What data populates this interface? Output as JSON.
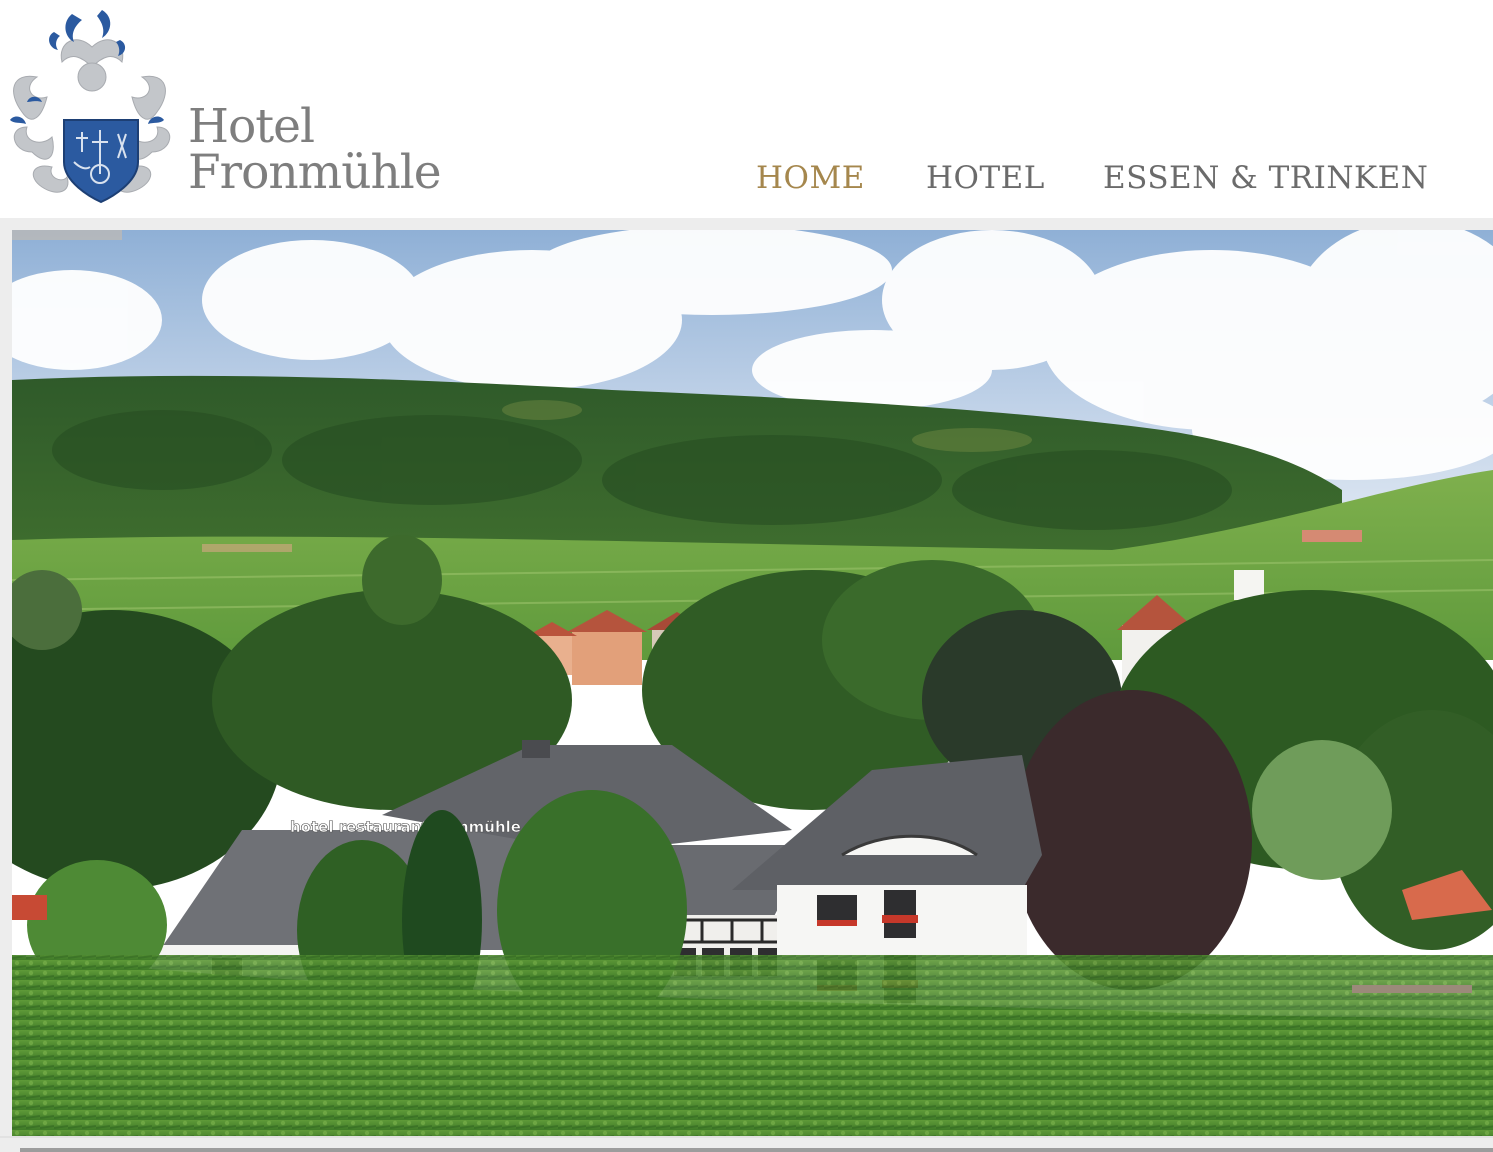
{
  "brand": {
    "line1": "Hotel",
    "line2": "Fronmühle",
    "crest_primary_color": "#2b5aa0",
    "crest_secondary_color": "#bfc3c8",
    "text_color": "#7e7e7e"
  },
  "nav": {
    "items": [
      {
        "label": "HOME",
        "active": true
      },
      {
        "label": "HOTEL",
        "active": false
      },
      {
        "label": "ESSEN & TRINKEN",
        "active": false
      }
    ],
    "active_color": "#a5874d",
    "color": "#6b6b6b"
  },
  "hero": {
    "image": "hotel-landscape-photo",
    "building_sign": "hotel restaurant fronmühle",
    "slider_active_index": 1
  }
}
